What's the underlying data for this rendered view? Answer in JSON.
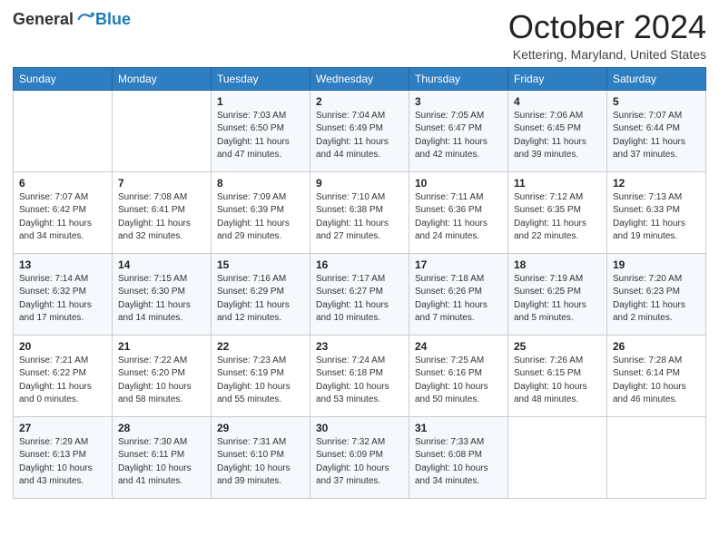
{
  "logo": {
    "general": "General",
    "blue": "Blue"
  },
  "header": {
    "month": "October 2024",
    "location": "Kettering, Maryland, United States"
  },
  "days_of_week": [
    "Sunday",
    "Monday",
    "Tuesday",
    "Wednesday",
    "Thursday",
    "Friday",
    "Saturday"
  ],
  "weeks": [
    [
      {
        "day": "",
        "sunrise": "",
        "sunset": "",
        "daylight": ""
      },
      {
        "day": "",
        "sunrise": "",
        "sunset": "",
        "daylight": ""
      },
      {
        "day": "1",
        "sunrise": "Sunrise: 7:03 AM",
        "sunset": "Sunset: 6:50 PM",
        "daylight": "Daylight: 11 hours and 47 minutes."
      },
      {
        "day": "2",
        "sunrise": "Sunrise: 7:04 AM",
        "sunset": "Sunset: 6:49 PM",
        "daylight": "Daylight: 11 hours and 44 minutes."
      },
      {
        "day": "3",
        "sunrise": "Sunrise: 7:05 AM",
        "sunset": "Sunset: 6:47 PM",
        "daylight": "Daylight: 11 hours and 42 minutes."
      },
      {
        "day": "4",
        "sunrise": "Sunrise: 7:06 AM",
        "sunset": "Sunset: 6:45 PM",
        "daylight": "Daylight: 11 hours and 39 minutes."
      },
      {
        "day": "5",
        "sunrise": "Sunrise: 7:07 AM",
        "sunset": "Sunset: 6:44 PM",
        "daylight": "Daylight: 11 hours and 37 minutes."
      }
    ],
    [
      {
        "day": "6",
        "sunrise": "Sunrise: 7:07 AM",
        "sunset": "Sunset: 6:42 PM",
        "daylight": "Daylight: 11 hours and 34 minutes."
      },
      {
        "day": "7",
        "sunrise": "Sunrise: 7:08 AM",
        "sunset": "Sunset: 6:41 PM",
        "daylight": "Daylight: 11 hours and 32 minutes."
      },
      {
        "day": "8",
        "sunrise": "Sunrise: 7:09 AM",
        "sunset": "Sunset: 6:39 PM",
        "daylight": "Daylight: 11 hours and 29 minutes."
      },
      {
        "day": "9",
        "sunrise": "Sunrise: 7:10 AM",
        "sunset": "Sunset: 6:38 PM",
        "daylight": "Daylight: 11 hours and 27 minutes."
      },
      {
        "day": "10",
        "sunrise": "Sunrise: 7:11 AM",
        "sunset": "Sunset: 6:36 PM",
        "daylight": "Daylight: 11 hours and 24 minutes."
      },
      {
        "day": "11",
        "sunrise": "Sunrise: 7:12 AM",
        "sunset": "Sunset: 6:35 PM",
        "daylight": "Daylight: 11 hours and 22 minutes."
      },
      {
        "day": "12",
        "sunrise": "Sunrise: 7:13 AM",
        "sunset": "Sunset: 6:33 PM",
        "daylight": "Daylight: 11 hours and 19 minutes."
      }
    ],
    [
      {
        "day": "13",
        "sunrise": "Sunrise: 7:14 AM",
        "sunset": "Sunset: 6:32 PM",
        "daylight": "Daylight: 11 hours and 17 minutes."
      },
      {
        "day": "14",
        "sunrise": "Sunrise: 7:15 AM",
        "sunset": "Sunset: 6:30 PM",
        "daylight": "Daylight: 11 hours and 14 minutes."
      },
      {
        "day": "15",
        "sunrise": "Sunrise: 7:16 AM",
        "sunset": "Sunset: 6:29 PM",
        "daylight": "Daylight: 11 hours and 12 minutes."
      },
      {
        "day": "16",
        "sunrise": "Sunrise: 7:17 AM",
        "sunset": "Sunset: 6:27 PM",
        "daylight": "Daylight: 11 hours and 10 minutes."
      },
      {
        "day": "17",
        "sunrise": "Sunrise: 7:18 AM",
        "sunset": "Sunset: 6:26 PM",
        "daylight": "Daylight: 11 hours and 7 minutes."
      },
      {
        "day": "18",
        "sunrise": "Sunrise: 7:19 AM",
        "sunset": "Sunset: 6:25 PM",
        "daylight": "Daylight: 11 hours and 5 minutes."
      },
      {
        "day": "19",
        "sunrise": "Sunrise: 7:20 AM",
        "sunset": "Sunset: 6:23 PM",
        "daylight": "Daylight: 11 hours and 2 minutes."
      }
    ],
    [
      {
        "day": "20",
        "sunrise": "Sunrise: 7:21 AM",
        "sunset": "Sunset: 6:22 PM",
        "daylight": "Daylight: 11 hours and 0 minutes."
      },
      {
        "day": "21",
        "sunrise": "Sunrise: 7:22 AM",
        "sunset": "Sunset: 6:20 PM",
        "daylight": "Daylight: 10 hours and 58 minutes."
      },
      {
        "day": "22",
        "sunrise": "Sunrise: 7:23 AM",
        "sunset": "Sunset: 6:19 PM",
        "daylight": "Daylight: 10 hours and 55 minutes."
      },
      {
        "day": "23",
        "sunrise": "Sunrise: 7:24 AM",
        "sunset": "Sunset: 6:18 PM",
        "daylight": "Daylight: 10 hours and 53 minutes."
      },
      {
        "day": "24",
        "sunrise": "Sunrise: 7:25 AM",
        "sunset": "Sunset: 6:16 PM",
        "daylight": "Daylight: 10 hours and 50 minutes."
      },
      {
        "day": "25",
        "sunrise": "Sunrise: 7:26 AM",
        "sunset": "Sunset: 6:15 PM",
        "daylight": "Daylight: 10 hours and 48 minutes."
      },
      {
        "day": "26",
        "sunrise": "Sunrise: 7:28 AM",
        "sunset": "Sunset: 6:14 PM",
        "daylight": "Daylight: 10 hours and 46 minutes."
      }
    ],
    [
      {
        "day": "27",
        "sunrise": "Sunrise: 7:29 AM",
        "sunset": "Sunset: 6:13 PM",
        "daylight": "Daylight: 10 hours and 43 minutes."
      },
      {
        "day": "28",
        "sunrise": "Sunrise: 7:30 AM",
        "sunset": "Sunset: 6:11 PM",
        "daylight": "Daylight: 10 hours and 41 minutes."
      },
      {
        "day": "29",
        "sunrise": "Sunrise: 7:31 AM",
        "sunset": "Sunset: 6:10 PM",
        "daylight": "Daylight: 10 hours and 39 minutes."
      },
      {
        "day": "30",
        "sunrise": "Sunrise: 7:32 AM",
        "sunset": "Sunset: 6:09 PM",
        "daylight": "Daylight: 10 hours and 37 minutes."
      },
      {
        "day": "31",
        "sunrise": "Sunrise: 7:33 AM",
        "sunset": "Sunset: 6:08 PM",
        "daylight": "Daylight: 10 hours and 34 minutes."
      },
      {
        "day": "",
        "sunrise": "",
        "sunset": "",
        "daylight": ""
      },
      {
        "day": "",
        "sunrise": "",
        "sunset": "",
        "daylight": ""
      }
    ]
  ]
}
